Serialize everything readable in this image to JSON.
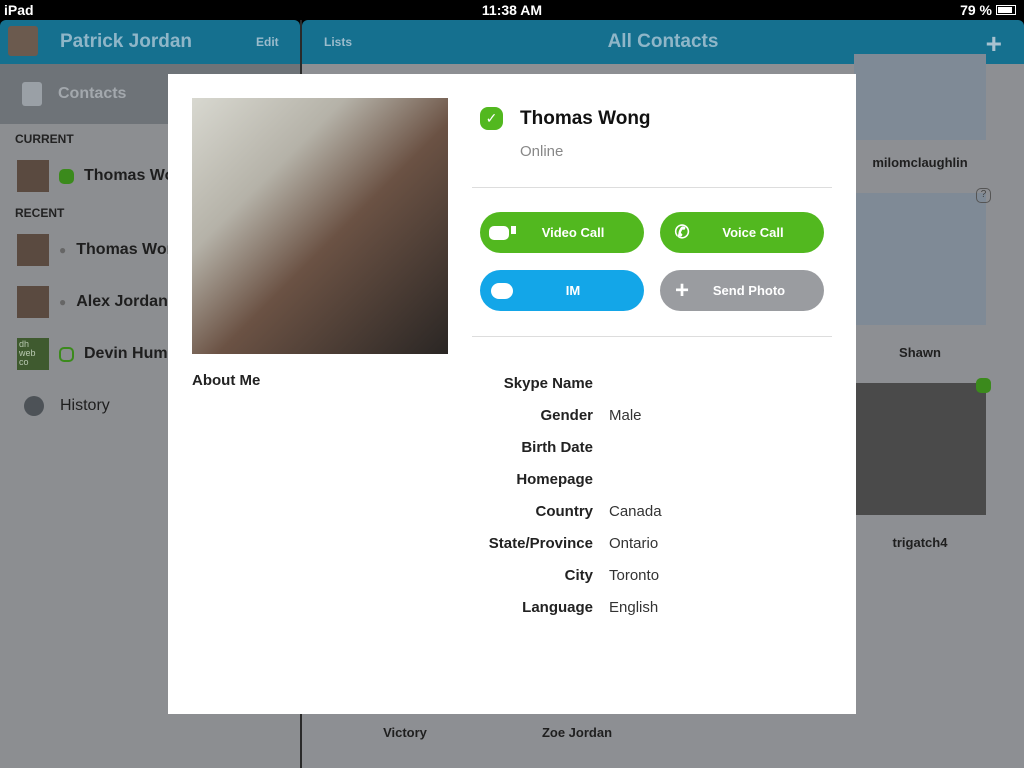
{
  "status": {
    "device": "iPad",
    "time": "11:38 AM",
    "battery": "79 %",
    "battery_level": 0.79
  },
  "sidebar": {
    "user": "Patrick Jordan",
    "edit": "Edit",
    "contacts": "Contacts",
    "current_label": "CURRENT",
    "recent_label": "RECENT",
    "current": [
      {
        "name": "Thomas Wong",
        "status": "online"
      }
    ],
    "recent": [
      {
        "name": "Thomas Wong",
        "icon": "group-icon"
      },
      {
        "name": "Alex Jordan",
        "icon": "group-icon"
      },
      {
        "name": "Devin Humbert",
        "icon": "online-outline-icon",
        "avatar_text": "dh web co"
      }
    ],
    "history": "History"
  },
  "main": {
    "lists": "Lists",
    "title": "All Contacts",
    "contacts": [
      {
        "name": "milomclaughlin"
      },
      {
        "name": "Shawn",
        "status": "unknown"
      },
      {
        "name": "trigatch4",
        "status": "online"
      },
      {
        "name": "Victory"
      },
      {
        "name": "Zoe Jordan"
      }
    ]
  },
  "profile": {
    "name": "Thomas Wong",
    "status": "Online",
    "about": "About Me",
    "buttons": {
      "video": "Video Call",
      "voice": "Voice Call",
      "im": "IM",
      "photo": "Send Photo"
    },
    "colors": {
      "green": "#52b81f",
      "blue": "#13a6e8",
      "grey": "#9a9ca0"
    },
    "fields": [
      {
        "k": "Skype Name",
        "v": ""
      },
      {
        "k": "Gender",
        "v": "Male"
      },
      {
        "k": "Birth Date",
        "v": ""
      },
      {
        "k": "Homepage",
        "v": ""
      },
      {
        "k": "Country",
        "v": "Canada"
      },
      {
        "k": "State/Province",
        "v": "Ontario"
      },
      {
        "k": "City",
        "v": "Toronto"
      },
      {
        "k": "Language",
        "v": "English"
      }
    ]
  }
}
